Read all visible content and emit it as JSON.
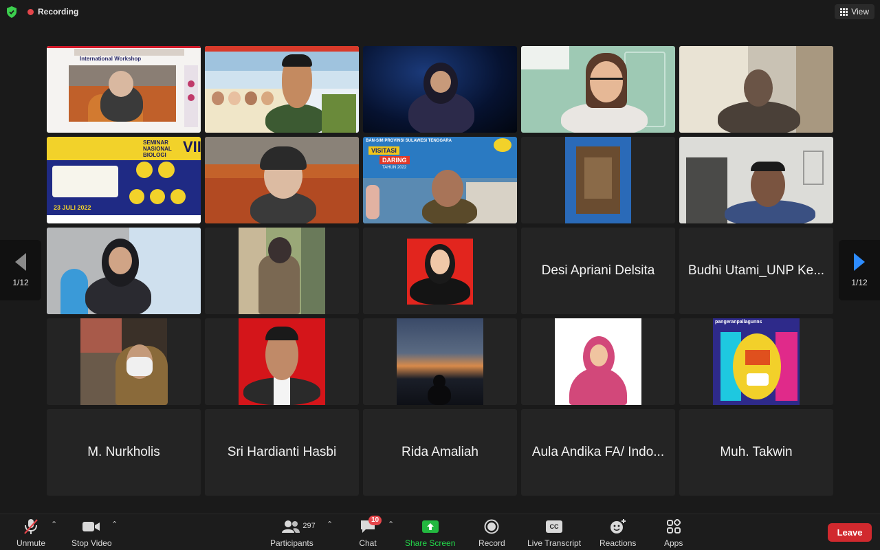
{
  "topbar": {
    "recording_label": "Recording",
    "view_label": "View"
  },
  "pager": {
    "left_label": "1/12",
    "right_label": "1/12"
  },
  "tiles_named": {
    "desi": "Desi Apriani Delsita",
    "budhi": "Budhi Utami_UNP Ke...",
    "nurkholis": "M. Nurkholis",
    "sri": "Sri Hardianti Hasbi",
    "rida": "Rida Amaliah",
    "aula": "Aula Andika FA/ Indo...",
    "takwin": "Muh. Takwin"
  },
  "video_text": {
    "workshop_title": "International Workshop",
    "seminar_title": "SEMINAR NASIONAL BIOLOGI",
    "seminar_num": "VII",
    "seminar_date": "23 JULI 2022",
    "ban_header": "BAN-S/M PROVINSI SULAWESI TENGGARA",
    "visitasi": "VISITASI",
    "daring": "DARING",
    "tahun": "TAHUN 2022",
    "pangeran": "pangeranpallagunns"
  },
  "toolbar": {
    "unmute": "Unmute",
    "stop_video": "Stop Video",
    "participants": "Participants",
    "participants_count": "297",
    "chat": "Chat",
    "chat_badge": "10",
    "share_screen": "Share Screen",
    "record": "Record",
    "live_transcript": "Live Transcript",
    "cc": "CC",
    "reactions": "Reactions",
    "apps": "Apps",
    "leave": "Leave"
  },
  "colors": {
    "accent_green": "#3ccf4e",
    "leave_red": "#d1292e",
    "badge_red": "#e5464b",
    "share_green": "#23b840"
  },
  "icons": [
    "shield-icon",
    "record-dot-icon",
    "grid-view-icon",
    "mic-muted-icon",
    "video-camera-icon",
    "participants-icon",
    "chat-icon",
    "share-screen-icon",
    "record-icon",
    "cc-icon",
    "reactions-icon",
    "apps-icon",
    "prev-arrow-icon",
    "next-arrow-icon"
  ]
}
